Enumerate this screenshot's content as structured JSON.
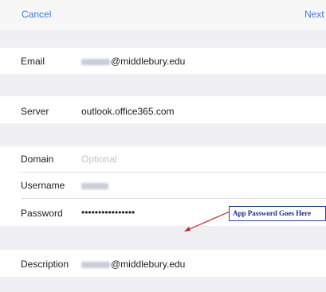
{
  "nav": {
    "cancel_label": "Cancel",
    "next_label": "Next"
  },
  "fields": {
    "email": {
      "label": "Email",
      "value_suffix": "@middlebury.edu"
    },
    "server": {
      "label": "Server",
      "value": "outlook.office365.com"
    },
    "domain": {
      "label": "Domain",
      "placeholder": "Optional"
    },
    "username": {
      "label": "Username"
    },
    "password": {
      "label": "Password",
      "value": "••••••••••••••••"
    },
    "description": {
      "label": "Description",
      "value_suffix": "@middlebury.edu"
    }
  },
  "annotation": {
    "text": "App Password Goes Here",
    "color": "#cc2222"
  },
  "colors": {
    "accent": "#3b7be0",
    "group_bg": "#efeff4",
    "row_bg": "#ffffff"
  }
}
